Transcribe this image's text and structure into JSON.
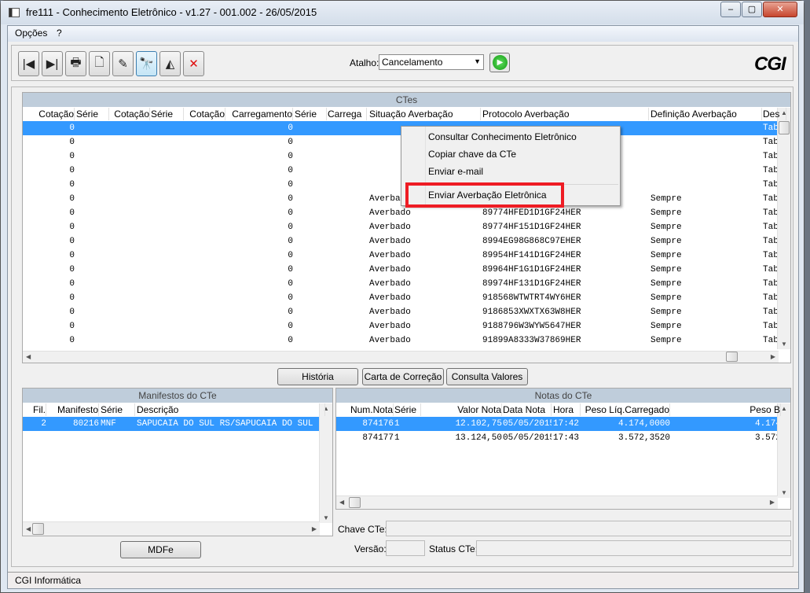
{
  "window": {
    "title": "fre111 - Conhecimento Eletrônico - v1.27 - 001.002 - 26/05/2015",
    "minimize": "‒",
    "maximize": "▢",
    "close": "✕"
  },
  "menu": [
    "Opções",
    "?"
  ],
  "toolbar": {
    "buttons": [
      {
        "name": "first-record",
        "glyph": "|◀"
      },
      {
        "name": "last-record",
        "glyph": "▶|"
      },
      {
        "name": "print",
        "glyph": "🖶"
      },
      {
        "name": "new",
        "glyph": "🗋"
      },
      {
        "name": "edit",
        "glyph": "✎"
      },
      {
        "name": "search",
        "glyph": "🔭"
      },
      {
        "name": "filter",
        "glyph": "◭"
      },
      {
        "name": "delete",
        "glyph": "✕"
      }
    ],
    "atalho_label": "Atalho:",
    "atalho_value": "Cancelamento",
    "go_glyph": "▶",
    "logo": "CGI"
  },
  "ctes": {
    "title": "CTes",
    "columns": [
      "Cotação",
      "Série",
      "Cotação",
      "Série",
      "Cotação",
      "Carregamento",
      "Série",
      "Carrega",
      "Situação Averbação",
      "Protocolo Averbação",
      "Definição Averbação",
      "Des"
    ],
    "rows": [
      [
        "0",
        "",
        "",
        "",
        "",
        "0",
        "",
        "",
        "",
        "",
        "",
        "Tab"
      ],
      [
        "0",
        "",
        "",
        "",
        "",
        "0",
        "",
        "",
        "",
        "",
        "",
        "Tab"
      ],
      [
        "0",
        "",
        "",
        "",
        "",
        "0",
        "",
        "",
        "",
        "",
        "",
        "Tab"
      ],
      [
        "0",
        "",
        "",
        "",
        "",
        "0",
        "",
        "",
        "",
        "",
        "",
        "Tab"
      ],
      [
        "0",
        "",
        "",
        "",
        "",
        "0",
        "",
        "",
        "",
        "",
        "",
        "Tab"
      ],
      [
        "0",
        "",
        "",
        "",
        "",
        "0",
        "",
        "",
        "Averbado",
        "",
        "Sempre",
        "Tab"
      ],
      [
        "0",
        "",
        "",
        "",
        "",
        "0",
        "",
        "",
        "Averbado",
        "89774HFED1D1GF24HER",
        "Sempre",
        "Tab"
      ],
      [
        "0",
        "",
        "",
        "",
        "",
        "0",
        "",
        "",
        "Averbado",
        "89774HF151D1GF24HER",
        "Sempre",
        "Tab"
      ],
      [
        "0",
        "",
        "",
        "",
        "",
        "0",
        "",
        "",
        "Averbado",
        "8994EG98G868C97EHER",
        "Sempre",
        "Tab"
      ],
      [
        "0",
        "",
        "",
        "",
        "",
        "0",
        "",
        "",
        "Averbado",
        "89954HF141D1GF24HER",
        "Sempre",
        "Tab"
      ],
      [
        "0",
        "",
        "",
        "",
        "",
        "0",
        "",
        "",
        "Averbado",
        "89964HF1G1D1GF24HER",
        "Sempre",
        "Tab"
      ],
      [
        "0",
        "",
        "",
        "",
        "",
        "0",
        "",
        "",
        "Averbado",
        "89974HF131D1GF24HER",
        "Sempre",
        "Tab"
      ],
      [
        "0",
        "",
        "",
        "",
        "",
        "0",
        "",
        "",
        "Averbado",
        "918568WTWTRT4WY6HER",
        "Sempre",
        "Tab"
      ],
      [
        "0",
        "",
        "",
        "",
        "",
        "0",
        "",
        "",
        "Averbado",
        "9186853XWXTX63W8HER",
        "Sempre",
        "Tab"
      ],
      [
        "0",
        "",
        "",
        "",
        "",
        "0",
        "",
        "",
        "Averbado",
        "9188796W3WYW5647HER",
        "Sempre",
        "Tab"
      ],
      [
        "0",
        "",
        "",
        "",
        "",
        "0",
        "",
        "",
        "Averbado",
        "91899A8333W37869HER",
        "Sempre",
        "Tab"
      ]
    ],
    "selected_row": 0
  },
  "context_menu": {
    "items": [
      "Consultar Conhecimento Eletrônico",
      "Copiar chave da CTe",
      "Enviar e-mail",
      "Enviar Averbação Eletrônica"
    ],
    "highlighted_item": "Enviar Averbação Eletrônica",
    "highlight_color": "#ee1c24"
  },
  "buttons": {
    "historia": "História",
    "carta": "Carta de Correção",
    "consulta": "Consulta Valores",
    "mdfe": "MDFe"
  },
  "manifestos": {
    "title": "Manifestos do CTe",
    "columns": [
      "Fil.",
      "Manifesto",
      "Série",
      "Descrição"
    ],
    "rows": [
      [
        "2",
        "80216",
        "MNF",
        "SAPUCAIA DO SUL RS/SAPUCAIA DO SUL"
      ]
    ]
  },
  "notas": {
    "title": "Notas do CTe",
    "columns": [
      "Num.Nota",
      "Série",
      "Valor Nota",
      "Data Nota",
      "Hora",
      "Peso Líq.Carregado",
      "Peso B"
    ],
    "rows": [
      [
        "874176",
        "1",
        "12.102,75",
        "05/05/2015",
        "17:42",
        "4.174,0000",
        "4.174"
      ],
      [
        "874177",
        "1",
        "13.124,50",
        "05/05/2015",
        "17:43",
        "3.572,3520",
        "3.572"
      ]
    ]
  },
  "fields": {
    "chave_label": "Chave CTe:",
    "chave_value": "",
    "versao_label": "Versão:",
    "versao_value": "",
    "status_label": "Status CTe:",
    "status_value": ""
  },
  "statusbar": "CGI Informática",
  "colors": {
    "selection": "#3399ff",
    "grid_title": "#bfcddb"
  }
}
